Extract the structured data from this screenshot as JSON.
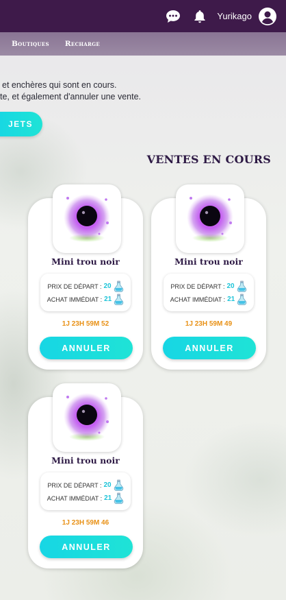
{
  "header": {
    "username": "Yurikago",
    "icons": [
      "chat-bubble-icon",
      "bell-icon",
      "user-avatar-icon"
    ]
  },
  "subnav": {
    "items": [
      {
        "label": "Boutiques"
      },
      {
        "label": "Recharge"
      }
    ]
  },
  "intro": {
    "line1": "et enchères qui sont en cours.",
    "line2": "te, et également d'annuler une vente."
  },
  "cta": {
    "label": "JETS"
  },
  "section": {
    "title": "VENTES EN COURS"
  },
  "sales": [
    {
      "name": "Mini trou noir",
      "start_label": "PRIX DE DÉPART :",
      "start_price": "20",
      "buy_label": "ACHAT IMMÉDIAT :",
      "buy_price": "21",
      "timer": "1J 23H 59M 52",
      "cancel_label": "ANNULER"
    },
    {
      "name": "Mini trou noir",
      "start_label": "PRIX DE DÉPART :",
      "start_price": "20",
      "buy_label": "ACHAT IMMÉDIAT :",
      "buy_price": "21",
      "timer": "1J 23H 59M 49",
      "cancel_label": "ANNULER"
    },
    {
      "name": "Mini trou noir",
      "start_label": "PRIX DE DÉPART :",
      "start_price": "20",
      "buy_label": "ACHAT IMMÉDIAT :",
      "buy_price": "21",
      "timer": "1J 23H 59M 46",
      "cancel_label": "ANNULER"
    }
  ],
  "colors": {
    "topbar": "#3e1a4a",
    "subnav": "#8a7594",
    "accent": "#17d6e4",
    "timer": "#e89014",
    "title": "#2e1a45"
  }
}
